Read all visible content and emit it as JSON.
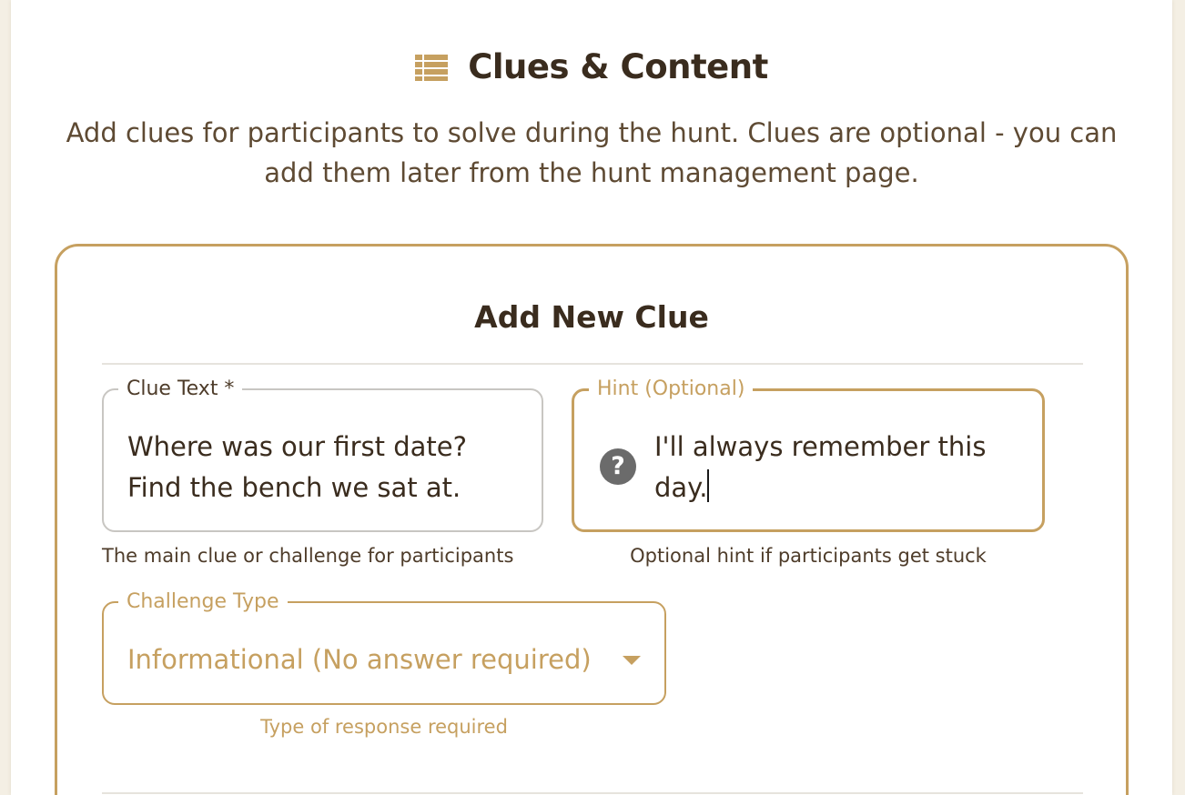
{
  "header": {
    "icon": "list-icon",
    "title": "Clues & Content",
    "description": "Add clues for participants to solve during the hunt. Clues are optional - you can add them later from the hunt management page."
  },
  "form": {
    "title": "Add New Clue",
    "clue_text": {
      "label": "Clue Text *",
      "value": "Where was our first date? Find the bench we sat at.",
      "helper": "The main clue or challenge for participants"
    },
    "hint": {
      "label": "Hint (Optional)",
      "value": "I'll always remember this day.",
      "icon": "help-icon",
      "helper": "Optional hint if participants get stuck"
    },
    "challenge_type": {
      "label": "Challenge Type",
      "value": "Informational (No answer required)",
      "icon": "dropdown-arrow-icon",
      "helper": "Type of response required"
    }
  },
  "colors": {
    "accent": "#c6a060",
    "heading": "#3a2c1e",
    "body_text": "#5e4a33",
    "help_icon_bg": "#6b6b6b"
  }
}
